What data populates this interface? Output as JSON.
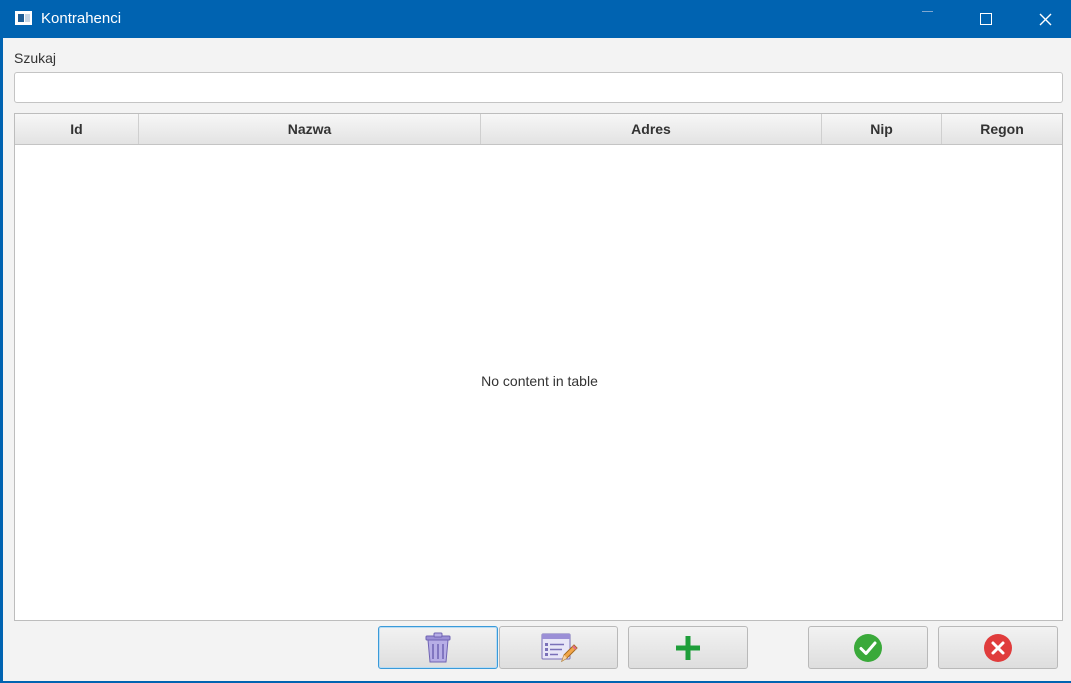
{
  "window": {
    "title": "Kontrahenci",
    "accent_color": "#0063b1",
    "controls": [
      "minimize-icon",
      "maximize-icon",
      "close-icon"
    ]
  },
  "search": {
    "label": "Szukaj",
    "value": "",
    "placeholder": ""
  },
  "table": {
    "columns": [
      "Id",
      "Nazwa",
      "Adres",
      "Nip",
      "Regon"
    ],
    "rows": [],
    "empty_message": "No content in table"
  },
  "actions": {
    "buttons": [
      {
        "name": "delete-button",
        "icon": "trash-icon"
      },
      {
        "name": "edit-button",
        "icon": "edit-form-icon"
      },
      {
        "name": "add-button",
        "icon": "plus-icon",
        "color": "#1e9e3a"
      },
      {
        "name": "confirm-button",
        "icon": "checkmark-icon",
        "color": "#3aa93a"
      },
      {
        "name": "cancel-button",
        "icon": "cancel-x-icon",
        "color": "#e03c3c"
      }
    ]
  }
}
